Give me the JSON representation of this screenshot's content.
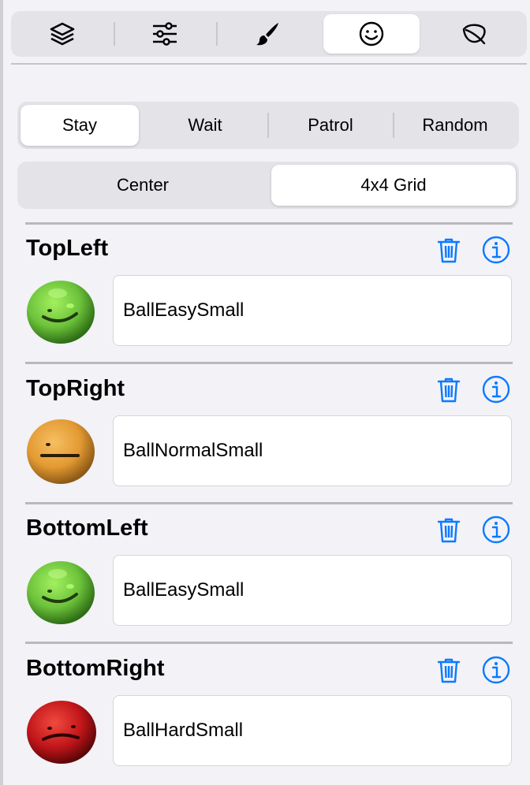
{
  "toolbar": {
    "items": [
      {
        "icon": "layers-icon"
      },
      {
        "icon": "sliders-icon"
      },
      {
        "icon": "paintbrush-icon"
      },
      {
        "icon": "smiley-icon",
        "selected": true
      },
      {
        "icon": "leaf-icon"
      }
    ]
  },
  "behavior": {
    "options": [
      "Stay",
      "Wait",
      "Patrol",
      "Random"
    ],
    "selected": "Stay"
  },
  "placement": {
    "options": [
      "Center",
      "4x4 Grid"
    ],
    "selected": "4x4 Grid"
  },
  "slots": [
    {
      "title": "TopLeft",
      "value": "BallEasySmall",
      "face": "easy"
    },
    {
      "title": "TopRight",
      "value": "BallNormalSmall",
      "face": "normal"
    },
    {
      "title": "BottomLeft",
      "value": "BallEasySmall",
      "face": "easy"
    },
    {
      "title": "BottomRight",
      "value": "BallHardSmall",
      "face": "hard"
    }
  ],
  "colors": {
    "accent": "#0a7aff",
    "easy": "#6cc23a",
    "normal": "#e59a35",
    "hard": "#cc1a1a"
  }
}
